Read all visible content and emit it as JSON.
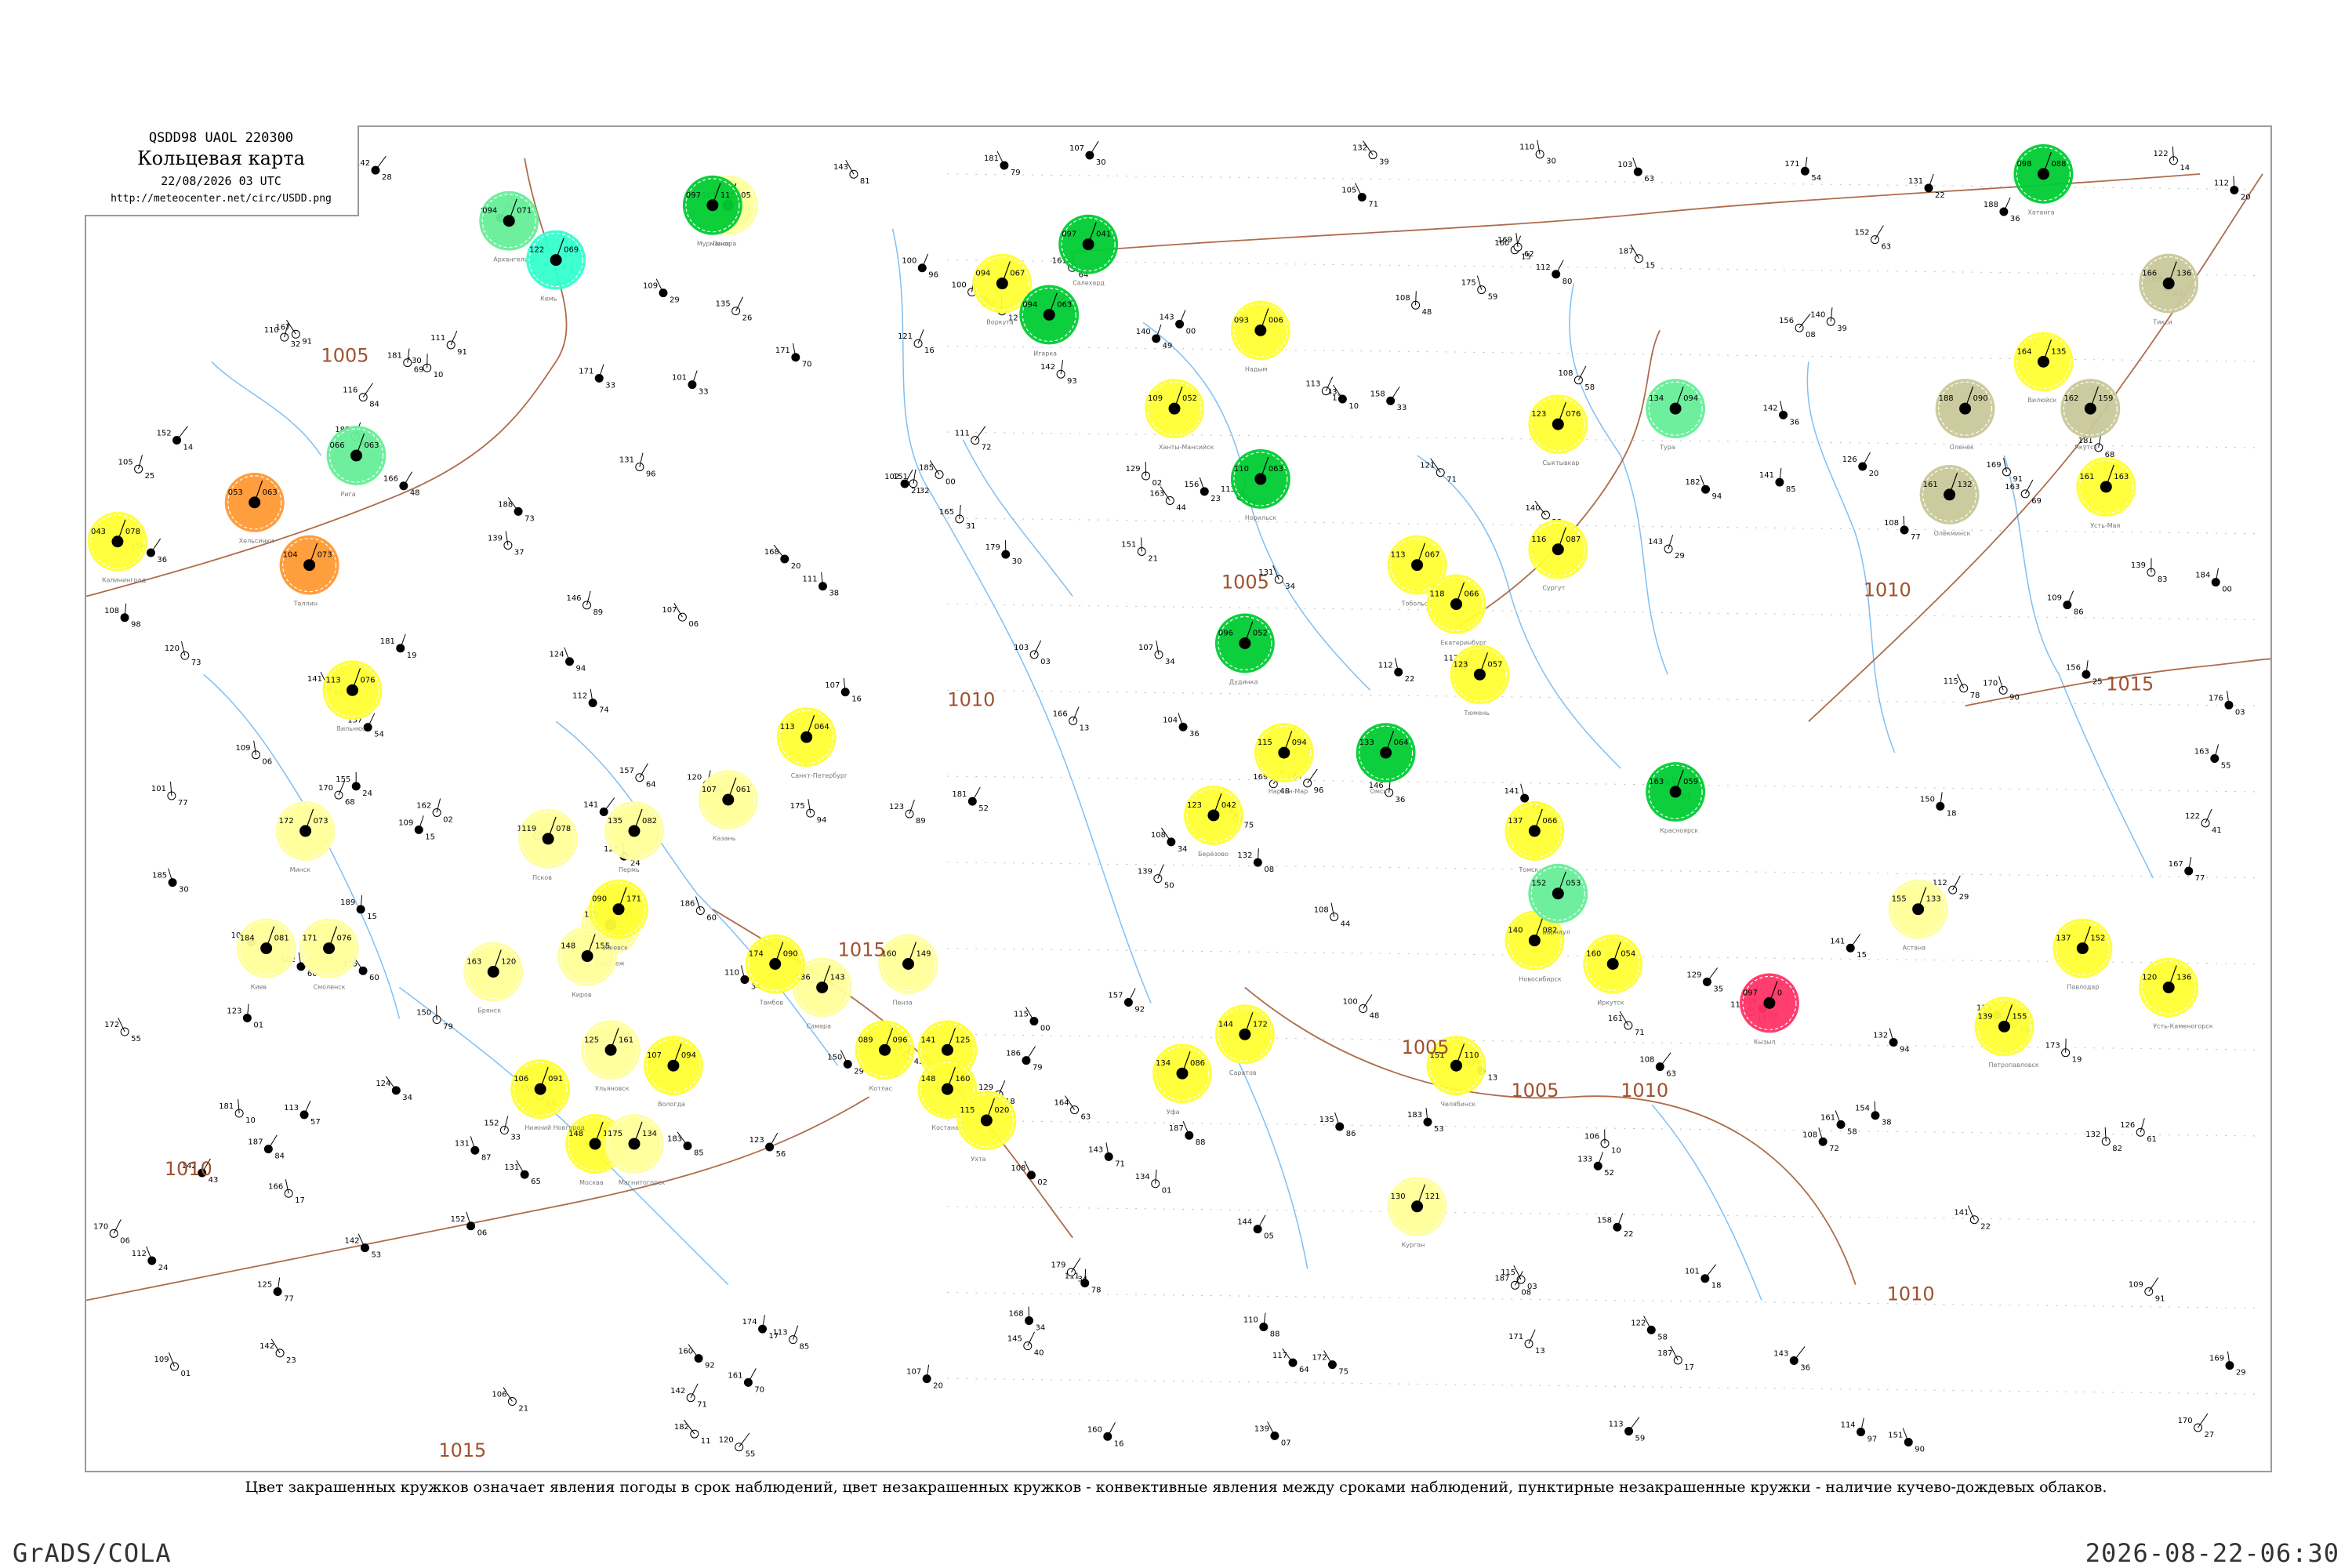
{
  "header": {
    "code_line": "QSDD98  UAOL  220300",
    "title": "Кольцевая карта",
    "datetime": "22/08/2026 03 UTC",
    "url": "http://meteocenter.net/circ/USDD.png"
  },
  "caption": "Цвет закрашенных кружков означает явления погоды в срок наблюдений, цвет незакрашенных кружков - конвективные явления между сроками наблюдений, пунктирные незакрашенные кружки - наличие кучево-дождевых облаков.",
  "footer": {
    "left": "GrADS/COLA",
    "right": "2026-08-22-06:30"
  },
  "colors": {
    "rain": "#00cc33",
    "drizzle": "#ffff33",
    "light_yellow": "#ffff99",
    "fog": "#c8c89a",
    "shower_teal": "#33ffcc",
    "mint": "#66ee99",
    "orange": "#ff9933",
    "thunder_red": "#ff3366",
    "isobar": "#a0522d",
    "river": "#55aaee"
  },
  "isobar_labels": [
    {
      "text": "1005"
    },
    {
      "text": "1005"
    },
    {
      "text": "1005"
    },
    {
      "text": "1005"
    },
    {
      "text": "1010"
    },
    {
      "text": "1010"
    },
    {
      "text": "1010"
    },
    {
      "text": "1010"
    },
    {
      "text": "1015"
    },
    {
      "text": "1015"
    },
    {
      "text": "1015"
    },
    {
      "text": "1010"
    }
  ],
  "stations": [
    {
      "name": "Печора",
      "temp": "104",
      "press": "105",
      "fill": "light_yellow"
    },
    {
      "name": "Мурманск",
      "temp": "097",
      "press": "11",
      "fill": "rain"
    },
    {
      "name": "Архангельск",
      "temp": "094",
      "press": "071",
      "fill": "mint"
    },
    {
      "name": "Кемь",
      "temp": "122",
      "press": "069",
      "fill": "shower_teal"
    },
    {
      "name": "Воркута",
      "temp": "094",
      "press": "067",
      "fill": "drizzle"
    },
    {
      "name": "Салехард",
      "temp": "097",
      "press": "041",
      "fill": "rain"
    },
    {
      "name": "Надым",
      "temp": "093",
      "press": "006",
      "fill": "drizzle"
    },
    {
      "name": "Игарка",
      "temp": "094",
      "press": "063",
      "fill": "rain"
    },
    {
      "name": "Хатанга",
      "temp": "098",
      "press": "088",
      "fill": "rain"
    },
    {
      "name": "Тикси",
      "temp": "166",
      "press": "136",
      "fill": "fog"
    },
    {
      "name": "Сыктывкар",
      "temp": "123",
      "press": "076",
      "fill": "drizzle"
    },
    {
      "name": "Тура",
      "temp": "134",
      "press": "094",
      "fill": "mint"
    },
    {
      "name": "Оленёк",
      "temp": "188",
      "press": "090",
      "fill": "fog"
    },
    {
      "name": "Вилюйск",
      "temp": "164",
      "press": "135",
      "fill": "drizzle"
    },
    {
      "name": "Якутск",
      "temp": "162",
      "press": "159",
      "fill": "fog"
    },
    {
      "name": "Усть-Мая",
      "temp": "161",
      "press": "163",
      "fill": "drizzle"
    },
    {
      "name": "Олёкминск",
      "temp": "161",
      "press": "132",
      "fill": "fog"
    },
    {
      "name": "Ханты-Мансийск",
      "temp": "109",
      "press": "052",
      "fill": "drizzle"
    },
    {
      "name": "Сургут",
      "temp": "116",
      "press": "087",
      "fill": "drizzle"
    },
    {
      "name": "Тобольск",
      "temp": "113",
      "press": "067",
      "fill": "drizzle"
    },
    {
      "name": "Екатеринбург",
      "temp": "118",
      "press": "066",
      "fill": "drizzle"
    },
    {
      "name": "Тюмень",
      "temp": "123",
      "press": "057",
      "fill": "drizzle"
    },
    {
      "name": "Омск",
      "temp": "133",
      "press": "064",
      "fill": "rain"
    },
    {
      "name": "Томск",
      "temp": "137",
      "press": "066",
      "fill": "drizzle"
    },
    {
      "name": "Новосибирск",
      "temp": "140",
      "press": "082",
      "fill": "drizzle"
    },
    {
      "name": "Барнаул",
      "temp": "152",
      "press": "053",
      "fill": "mint"
    },
    {
      "name": "Красноярск",
      "temp": "163",
      "press": "059",
      "fill": "rain"
    },
    {
      "name": "Кызыл",
      "temp": "097",
      "press": "0",
      "fill": "thunder_red"
    },
    {
      "name": "Иркутск",
      "temp": "160",
      "press": "054",
      "fill": "drizzle"
    },
    {
      "name": "Москва",
      "temp": "148",
      "press": "160",
      "fill": "drizzle"
    },
    {
      "name": "Санкт-Петербург",
      "temp": "113",
      "press": "064",
      "fill": "drizzle"
    },
    {
      "name": "Минск",
      "temp": "172",
      "press": "073",
      "fill": "light_yellow"
    },
    {
      "name": "Киев",
      "temp": "184",
      "press": "081",
      "fill": "light_yellow"
    },
    {
      "name": "Казань",
      "temp": "107",
      "press": "061",
      "fill": "light_yellow"
    },
    {
      "name": "Самара",
      "temp": "136",
      "press": "143",
      "fill": "light_yellow"
    },
    {
      "name": "Пермь",
      "temp": "135",
      "press": "082",
      "fill": "light_yellow"
    },
    {
      "name": "Оренбург",
      "temp": "141",
      "press": "125",
      "fill": "drizzle"
    },
    {
      "name": "Уфа",
      "temp": "134",
      "press": "086",
      "fill": "drizzle"
    },
    {
      "name": "Челябинск",
      "temp": "151",
      "press": "110",
      "fill": "drizzle"
    },
    {
      "name": "Курган",
      "temp": "130",
      "press": "121",
      "fill": "light_yellow"
    },
    {
      "name": "Петропавловск",
      "temp": "139",
      "press": "155",
      "fill": "drizzle"
    },
    {
      "name": "Астана",
      "temp": "155",
      "press": "133",
      "fill": "light_yellow"
    },
    {
      "name": "Павлодар",
      "temp": "137",
      "press": "152",
      "fill": "drizzle"
    },
    {
      "name": "Усть-Каменогорск",
      "temp": "120",
      "press": "136",
      "fill": "drizzle"
    },
    {
      "name": "Хельсинки",
      "temp": "053",
      "press": "063",
      "fill": "orange"
    },
    {
      "name": "Таллин",
      "temp": "104",
      "press": "073",
      "fill": "orange"
    },
    {
      "name": "Рига",
      "temp": "066",
      "press": "063",
      "fill": "mint"
    },
    {
      "name": "Вильнюс",
      "temp": "113",
      "press": "076",
      "fill": "drizzle"
    },
    {
      "name": "Калининград",
      "temp": "043",
      "press": "078",
      "fill": "drizzle"
    },
    {
      "name": "Псков",
      "temp": "119",
      "press": "078",
      "fill": "light_yellow"
    },
    {
      "name": "Смоленск",
      "temp": "171",
      "press": "076",
      "fill": "light_yellow"
    },
    {
      "name": "Брянск",
      "temp": "163",
      "press": "120",
      "fill": "light_yellow"
    },
    {
      "name": "Воронеж",
      "temp": "170",
      "press": "131",
      "fill": "light_yellow"
    },
    {
      "name": "Тамбов",
      "temp": "174",
      "press": "090",
      "fill": "drizzle"
    },
    {
      "name": "Пенза",
      "temp": "160",
      "press": "149",
      "fill": "light_yellow"
    },
    {
      "name": "Саратов",
      "temp": "144",
      "press": "172",
      "fill": "drizzle"
    },
    {
      "name": "Нижний Новгород",
      "temp": "106",
      "press": "091",
      "fill": "drizzle"
    },
    {
      "name": "Вологда",
      "temp": "107",
      "press": "094",
      "fill": "drizzle"
    },
    {
      "name": "Котлас",
      "temp": "089",
      "press": "096",
      "fill": "drizzle"
    },
    {
      "name": "Киров",
      "temp": "148",
      "press": "155",
      "fill": "light_yellow"
    },
    {
      "name": "Ижевск",
      "temp": "090",
      "press": "171",
      "fill": "drizzle"
    },
    {
      "name": "Ульяновск",
      "temp": "125",
      "press": "161",
      "fill": "light_yellow"
    },
    {
      "name": "Магнитогорск",
      "temp": "175",
      "press": "134",
      "fill": "light_yellow"
    },
    {
      "name": "Костанай",
      "temp": "148",
      "press": "160",
      "fill": "drizzle"
    },
    {
      "name": "Ухта",
      "temp": "115",
      "press": "020",
      "fill": "drizzle"
    },
    {
      "name": "Берёзово",
      "temp": "123",
      "press": "042",
      "fill": "drizzle"
    },
    {
      "name": "Нарьян-Мар",
      "temp": "115",
      "press": "094",
      "fill": "drizzle"
    },
    {
      "name": "Дудинка",
      "temp": "096",
      "press": "052",
      "fill": "rain"
    },
    {
      "name": "Норильск",
      "temp": "110",
      "press": "063",
      "fill": "rain"
    }
  ]
}
